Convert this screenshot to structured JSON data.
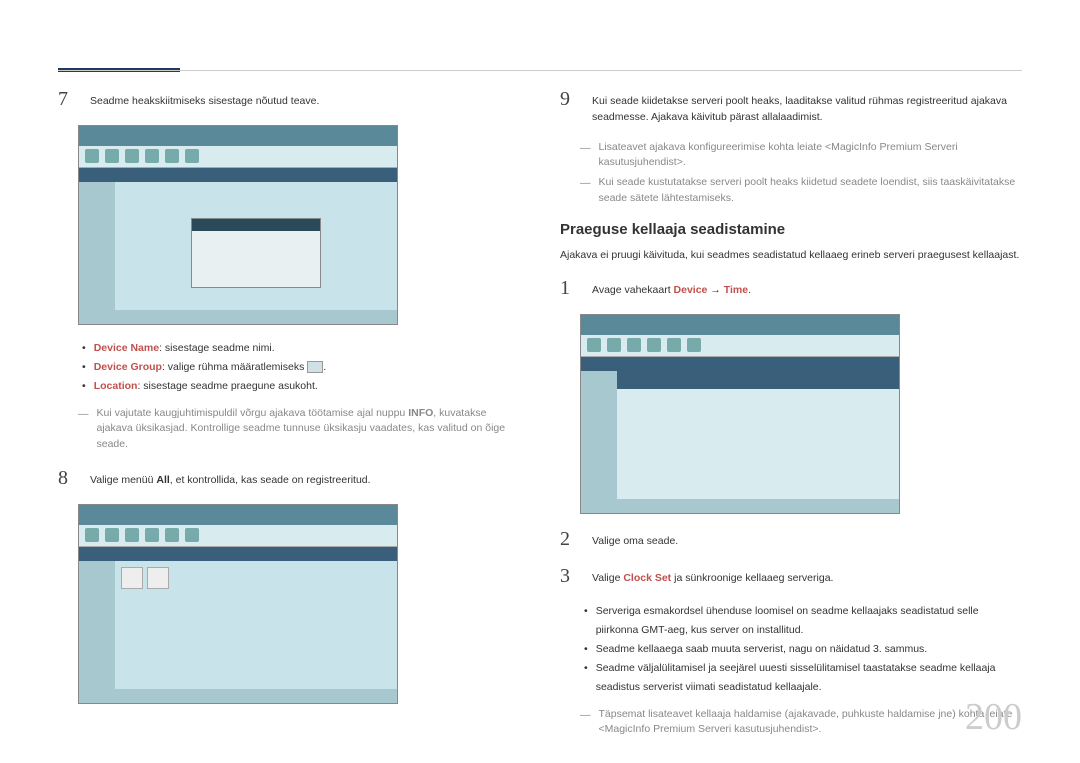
{
  "left": {
    "step7": "Seadme heakskiitmiseks sisestage nõutud teave.",
    "bullets": [
      {
        "label": "Device Name",
        "text": ": sisestage seadme nimi."
      },
      {
        "label": "Device Group",
        "text": ": valige rühma määratlemiseks ",
        "hasIcon": true,
        "after": "."
      },
      {
        "label": "Location",
        "text": ": sisestage seadme praegune asukoht."
      }
    ],
    "note7": "Kui vajutate kaugjuhtimispuldil võrgu ajakava töötamise ajal nuppu INFO, kuvatakse ajakava üksikasjad. Kontrollige seadme tunnuse üksikasju vaadates, kas valitud on õige seade.",
    "note7_bold": "INFO",
    "step8_pre": "Valige menüü ",
    "step8_bold": "All",
    "step8_post": ", et kontrollida, kas seade on registreeritud."
  },
  "right": {
    "step9": "Kui seade kiidetakse serveri poolt heaks, laaditakse valitud rühmas registreeritud ajakava seadmesse. Ajakava käivitub pärast allalaadimist.",
    "notes9": [
      "Lisateavet ajakava konfigureerimise kohta leiate <MagicInfo Premium Serveri kasutusjuhendist>.",
      "Kui seade kustutatakse serveri poolt heaks kiidetud seadete loendist, siis taaskäivitatakse seade sätete lähtestamiseks."
    ],
    "section_title": "Praeguse kellaaja seadistamine",
    "section_desc": "Ajakava ei pruugi käivituda, kui seadmes seadistatud kellaaeg erineb serveri praegusest kellaajast.",
    "step1_pre": "Avage vahekaart ",
    "step1_bold1": "Device",
    "step1_arrow": " → ",
    "step1_bold2": "Time",
    "step1_end": ".",
    "step2": "Valige oma seade.",
    "step3_pre": "Valige ",
    "step3_bold": "Clock Set",
    "step3_post": " ja sünkroonige kellaaeg serveriga.",
    "bullets3": [
      "Serveriga esmakordsel ühenduse loomisel on seadme kellaajaks seadistatud selle piirkonna GMT-aeg, kus server on installitud.",
      "Seadme kellaaega saab muuta serverist, nagu on näidatud 3. sammus.",
      "Seadme väljalülitamisel ja seejärel uuesti sisselülitamisel taastatakse seadme kellaaja seadistus serverist viimati seadistatud kellaajale."
    ],
    "note_final": "Täpsemat lisateavet kellaaja haldamise (ajakavade, puhkuste haldamise jne) kohta leiate <MagicInfo Premium Serveri kasutusjuhendist>."
  },
  "page_num": "200"
}
